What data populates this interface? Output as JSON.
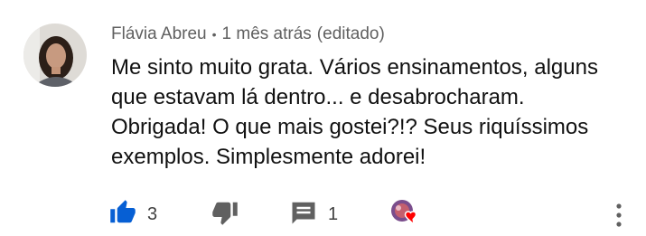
{
  "comment": {
    "author": "Flávia Abreu",
    "separator": "•",
    "time": "1 mês atrás",
    "edited": "(editado)",
    "lines": [
      "Me sinto muito grata. Vários ensinamentos, alguns",
      "que estavam lá dentro... e desabrocharam.",
      "Obrigada! O que mais gostei?!? Seus riquíssimos",
      "exemplos. Simplesmente adorei!"
    ]
  },
  "actions": {
    "like_count": "3",
    "reply_count": "1"
  },
  "icons": {
    "like": "thumbs-up-icon",
    "dislike": "thumbs-down-icon",
    "reply": "comment-icon",
    "heart": "creator-heart-icon",
    "menu": "more-vert-icon"
  },
  "colors": {
    "accent": "#065fd4",
    "icon": "#606060",
    "heart": "#ff0000"
  }
}
